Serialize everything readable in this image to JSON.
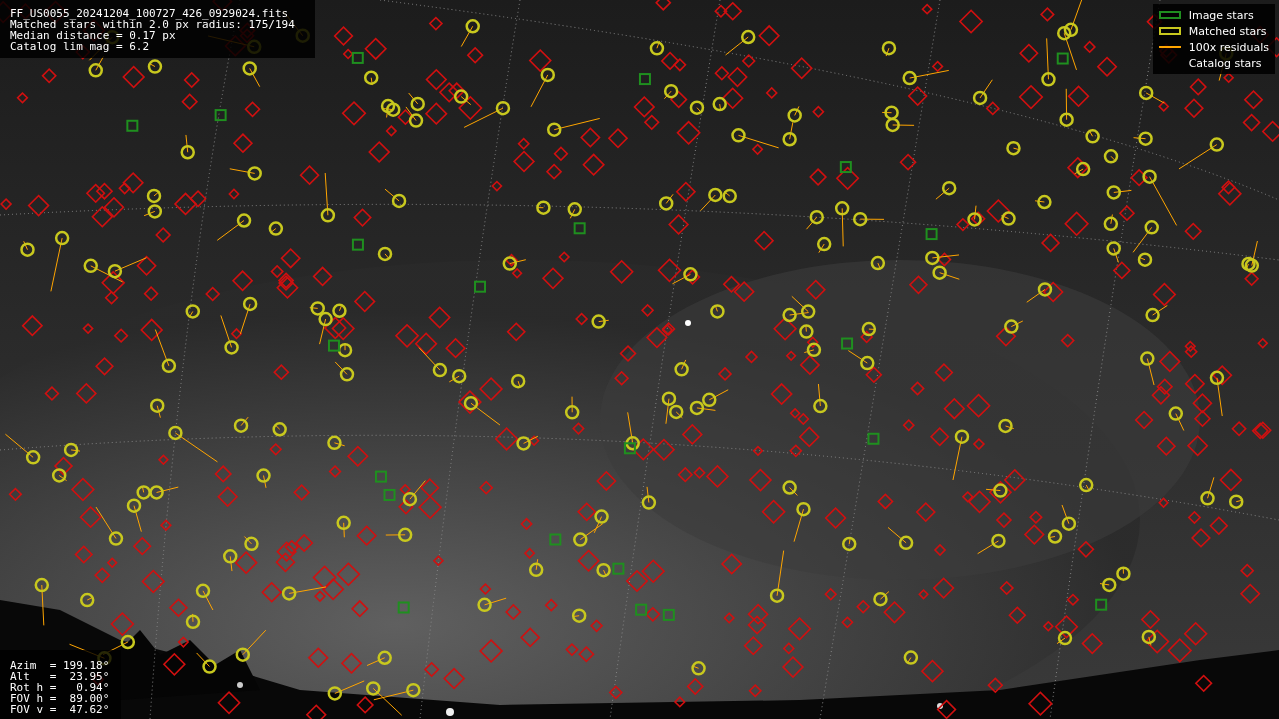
{
  "info": {
    "lines": [
      "FF_US0055_20241204_100727_426_0929024.fits",
      "Matched stars within 2.0 px radius: 175/194",
      "Median distance = 0.17 px",
      "Catalog lim mag = 6.2"
    ]
  },
  "legend": [
    {
      "kind": "box",
      "label": "Image stars",
      "color": "#1f8f1f"
    },
    {
      "kind": "box",
      "label": "Matched stars",
      "color": "#c8c81e"
    },
    {
      "kind": "line",
      "label": "100x residuals",
      "color": "#ffa500"
    },
    {
      "kind": "none",
      "label": "Catalog stars"
    }
  ],
  "pointing": [
    "Azim  = 199.18°",
    "Alt   =  23.95°",
    "Rot h =   0.94°",
    "FOV h =  89.00°",
    "FOV v =  47.62°"
  ]
}
